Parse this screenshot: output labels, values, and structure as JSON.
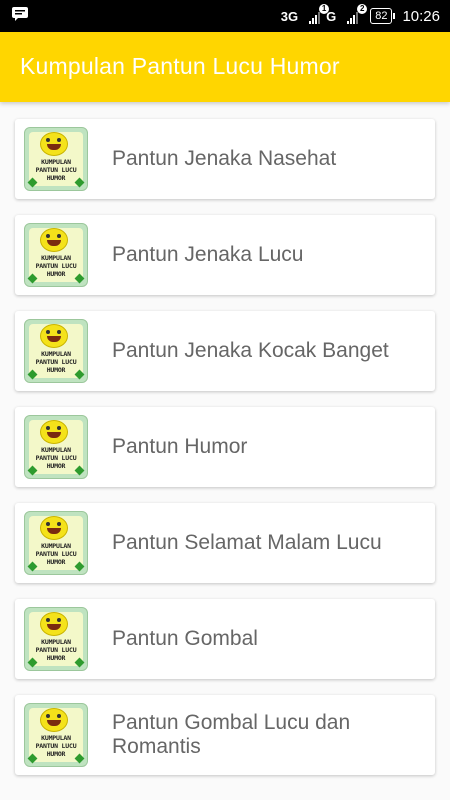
{
  "status_bar": {
    "net1": "3G",
    "sim1": "1",
    "net2": "G",
    "sim2": "2",
    "battery": "82",
    "time": "10:26"
  },
  "app_bar": {
    "title": "Kumpulan Pantun Lucu Humor"
  },
  "thumbnail_text": [
    "KUMPULAN",
    "PANTUN LUCU",
    "HUMOR"
  ],
  "items": [
    {
      "label": "Pantun Jenaka Nasehat"
    },
    {
      "label": "Pantun Jenaka Lucu"
    },
    {
      "label": "Pantun Jenaka Kocak Banget"
    },
    {
      "label": "Pantun Humor"
    },
    {
      "label": "Pantun Selamat Malam Lucu"
    },
    {
      "label": "Pantun Gombal"
    },
    {
      "label": "Pantun Gombal Lucu dan Romantis"
    }
  ],
  "icons": {
    "notification": "chat-notification-icon",
    "smiley": "smiley-icon"
  },
  "colors": {
    "app_bar": "#ffd600",
    "label_text": "#666666"
  }
}
